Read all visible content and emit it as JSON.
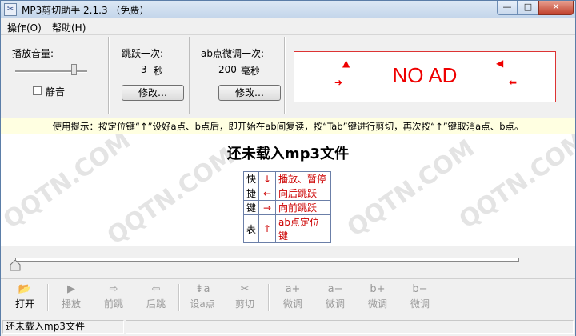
{
  "window": {
    "title": "MP3剪切助手 2.1.3 （免费）",
    "controls": {
      "min": "—",
      "max": "□",
      "close": "✕"
    }
  },
  "menu": [
    "操作(O)",
    "帮助(H)"
  ],
  "volume": {
    "label": "播放音量:",
    "level": 0.82,
    "mute_label": "静音",
    "mute_checked": false
  },
  "jump": {
    "label": "跳跃一次:",
    "value": "3",
    "unit": "秒",
    "button": "修改…"
  },
  "ab_adjust": {
    "label": "ab点微调一次:",
    "value": "200",
    "unit": "毫秒",
    "button": "修改…"
  },
  "ad": {
    "text": "NO AD",
    "color": "#ee0000"
  },
  "hint": "使用提示：按定位键“↑”设好a点、b点后，即开始在ab间复读，按“Tab”键进行剪切，再次按“↑”键取消a点、b点。",
  "main": {
    "title_prefix": "还未载入",
    "title_bold": "mp3",
    "title_suffix": "文件",
    "watermark": "QQTN.COM",
    "shortcut_side": [
      "快",
      "捷",
      "键",
      "表"
    ],
    "shortcuts": [
      {
        "key": "↓",
        "action": "播放、暂停"
      },
      {
        "key": "←",
        "action": "向后跳跃"
      },
      {
        "key": "→",
        "action": "向前跳跃"
      },
      {
        "key": "↑",
        "action": "ab点定位键"
      }
    ]
  },
  "seek": {
    "position": 0
  },
  "toolbar": [
    {
      "id": "open",
      "icon": "folder-icon",
      "glyph": "📂",
      "label": "打开",
      "enabled": true
    },
    {
      "id": "play",
      "icon": "play-icon",
      "glyph": "▶",
      "label": "播放",
      "enabled": false
    },
    {
      "id": "forward",
      "icon": "forward-icon",
      "glyph": "⇨",
      "label": "前跳",
      "enabled": false
    },
    {
      "id": "backward",
      "icon": "backward-icon",
      "glyph": "⇦",
      "label": "后跳",
      "enabled": false
    },
    {
      "id": "set-a",
      "icon": "set-a-icon",
      "glyph": "⇟a",
      "label": "设a点",
      "enabled": false
    },
    {
      "id": "cut",
      "icon": "scissors-icon",
      "glyph": "✂",
      "label": "剪切",
      "enabled": false
    },
    {
      "id": "a-plus",
      "icon": "a-plus-icon",
      "glyph": "a+",
      "label": "微调",
      "enabled": false
    },
    {
      "id": "a-minus",
      "icon": "a-minus-icon",
      "glyph": "a−",
      "label": "微调",
      "enabled": false
    },
    {
      "id": "b-plus",
      "icon": "b-plus-icon",
      "glyph": "b+",
      "label": "微调",
      "enabled": false
    },
    {
      "id": "b-minus",
      "icon": "b-minus-icon",
      "glyph": "b−",
      "label": "微调",
      "enabled": false
    }
  ],
  "status": {
    "text": "还未载入mp3文件"
  }
}
